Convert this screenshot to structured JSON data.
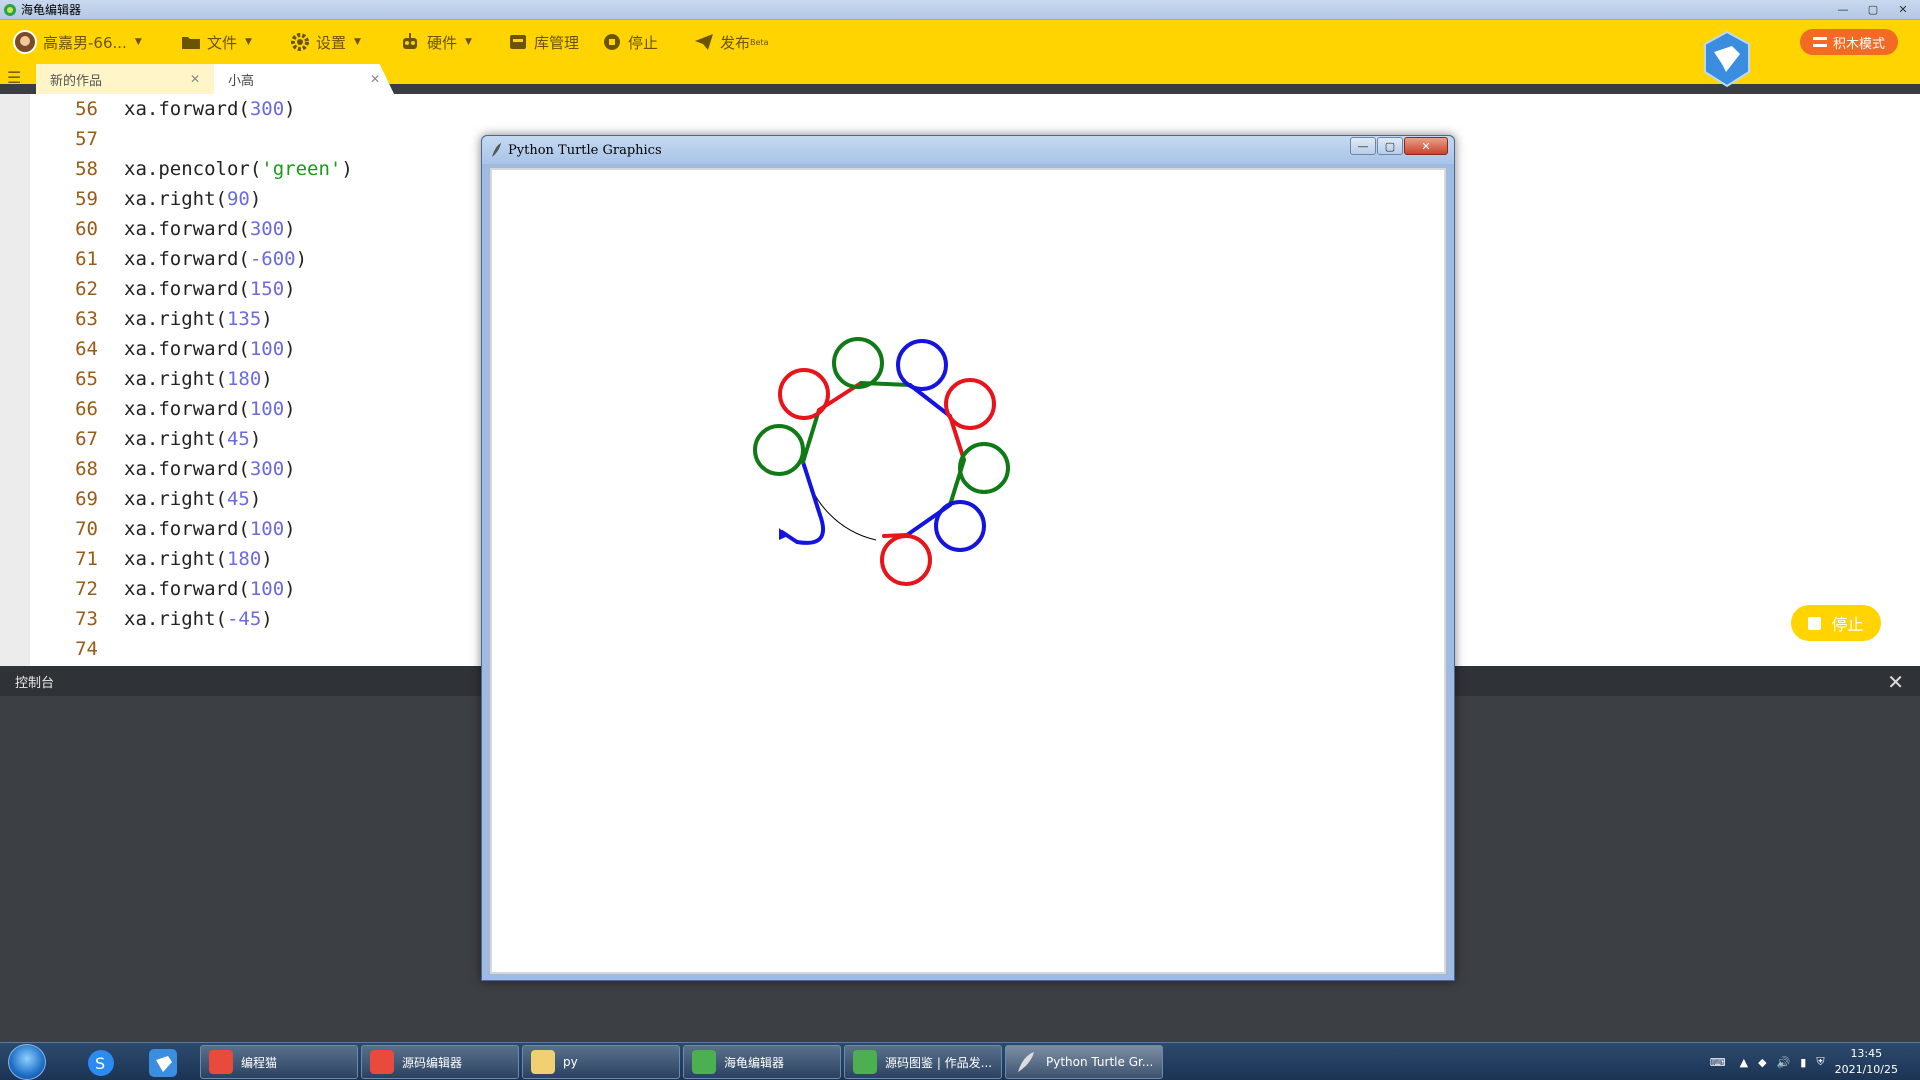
{
  "app": {
    "title": "海龟编辑器",
    "window_controls": [
      "—",
      "▢",
      "✕"
    ]
  },
  "toolbar": {
    "user": "高嘉男-66...",
    "file": "文件",
    "settings": "设置",
    "hardware": "硬件",
    "library": "库管理",
    "stop": "停止",
    "publish": "发布",
    "publish_badge": "Beta",
    "block_mode": "积木模式"
  },
  "tabs": [
    {
      "label": "新的作品",
      "close": "✕"
    },
    {
      "label": "小高",
      "close": "✕"
    }
  ],
  "code": [
    {
      "n": "56",
      "tokens": [
        {
          "t": "xa.forward("
        },
        {
          "t": "300",
          "c": "num"
        },
        {
          "t": ")"
        }
      ]
    },
    {
      "n": "57",
      "tokens": []
    },
    {
      "n": "58",
      "tokens": [
        {
          "t": "xa.pencolor("
        },
        {
          "t": "'green'",
          "c": "str"
        },
        {
          "t": ")"
        }
      ]
    },
    {
      "n": "59",
      "tokens": [
        {
          "t": "xa.right("
        },
        {
          "t": "90",
          "c": "num"
        },
        {
          "t": ")"
        }
      ]
    },
    {
      "n": "60",
      "tokens": [
        {
          "t": "xa.forward("
        },
        {
          "t": "300",
          "c": "num"
        },
        {
          "t": ")"
        }
      ]
    },
    {
      "n": "61",
      "tokens": [
        {
          "t": "xa.forward("
        },
        {
          "t": "-600",
          "c": "num"
        },
        {
          "t": ")"
        }
      ]
    },
    {
      "n": "62",
      "tokens": [
        {
          "t": "xa.forward("
        },
        {
          "t": "150",
          "c": "num"
        },
        {
          "t": ")"
        }
      ]
    },
    {
      "n": "63",
      "tokens": [
        {
          "t": "xa.right("
        },
        {
          "t": "135",
          "c": "num"
        },
        {
          "t": ")"
        }
      ]
    },
    {
      "n": "64",
      "tokens": [
        {
          "t": "xa.forward("
        },
        {
          "t": "100",
          "c": "num"
        },
        {
          "t": ")"
        }
      ]
    },
    {
      "n": "65",
      "tokens": [
        {
          "t": "xa.right("
        },
        {
          "t": "180",
          "c": "num"
        },
        {
          "t": ")"
        }
      ]
    },
    {
      "n": "66",
      "tokens": [
        {
          "t": "xa.forward("
        },
        {
          "t": "100",
          "c": "num"
        },
        {
          "t": ")"
        }
      ]
    },
    {
      "n": "67",
      "tokens": [
        {
          "t": "xa.right("
        },
        {
          "t": "45",
          "c": "num"
        },
        {
          "t": ")"
        }
      ]
    },
    {
      "n": "68",
      "tokens": [
        {
          "t": "xa.forward("
        },
        {
          "t": "300",
          "c": "num"
        },
        {
          "t": ")"
        }
      ]
    },
    {
      "n": "69",
      "tokens": [
        {
          "t": "xa.right("
        },
        {
          "t": "45",
          "c": "num"
        },
        {
          "t": ")"
        }
      ]
    },
    {
      "n": "70",
      "tokens": [
        {
          "t": "xa.forward("
        },
        {
          "t": "100",
          "c": "num"
        },
        {
          "t": ")"
        }
      ]
    },
    {
      "n": "71",
      "tokens": [
        {
          "t": "xa.right("
        },
        {
          "t": "180",
          "c": "num"
        },
        {
          "t": ")"
        }
      ]
    },
    {
      "n": "72",
      "tokens": [
        {
          "t": "xa.forward("
        },
        {
          "t": "100",
          "c": "num"
        },
        {
          "t": ")"
        }
      ]
    },
    {
      "n": "73",
      "tokens": [
        {
          "t": "xa.right("
        },
        {
          "t": "-45",
          "c": "num"
        },
        {
          "t": ")"
        }
      ]
    },
    {
      "n": "74",
      "tokens": []
    }
  ],
  "console": {
    "title": "控制台",
    "close": "✕"
  },
  "float_stop": "停止",
  "turtle_window": {
    "title": "Python Turtle Graphics",
    "controls": [
      "—",
      "▢",
      "✕"
    ],
    "colors": {
      "red": "#e8141c",
      "green": "#0f7a16",
      "blue": "#1414e0"
    }
  },
  "taskbar": {
    "tasks": [
      "编程猫",
      "源码编辑器",
      "py",
      "海龟编辑器",
      "源码图鉴 | 作品发...",
      "Python Turtle Gr..."
    ],
    "time": "13:45",
    "date": "2021/10/25"
  },
  "colors": {
    "toolbar": "#ffd400",
    "accent": "#f26a23",
    "console": "#3c3f43"
  }
}
